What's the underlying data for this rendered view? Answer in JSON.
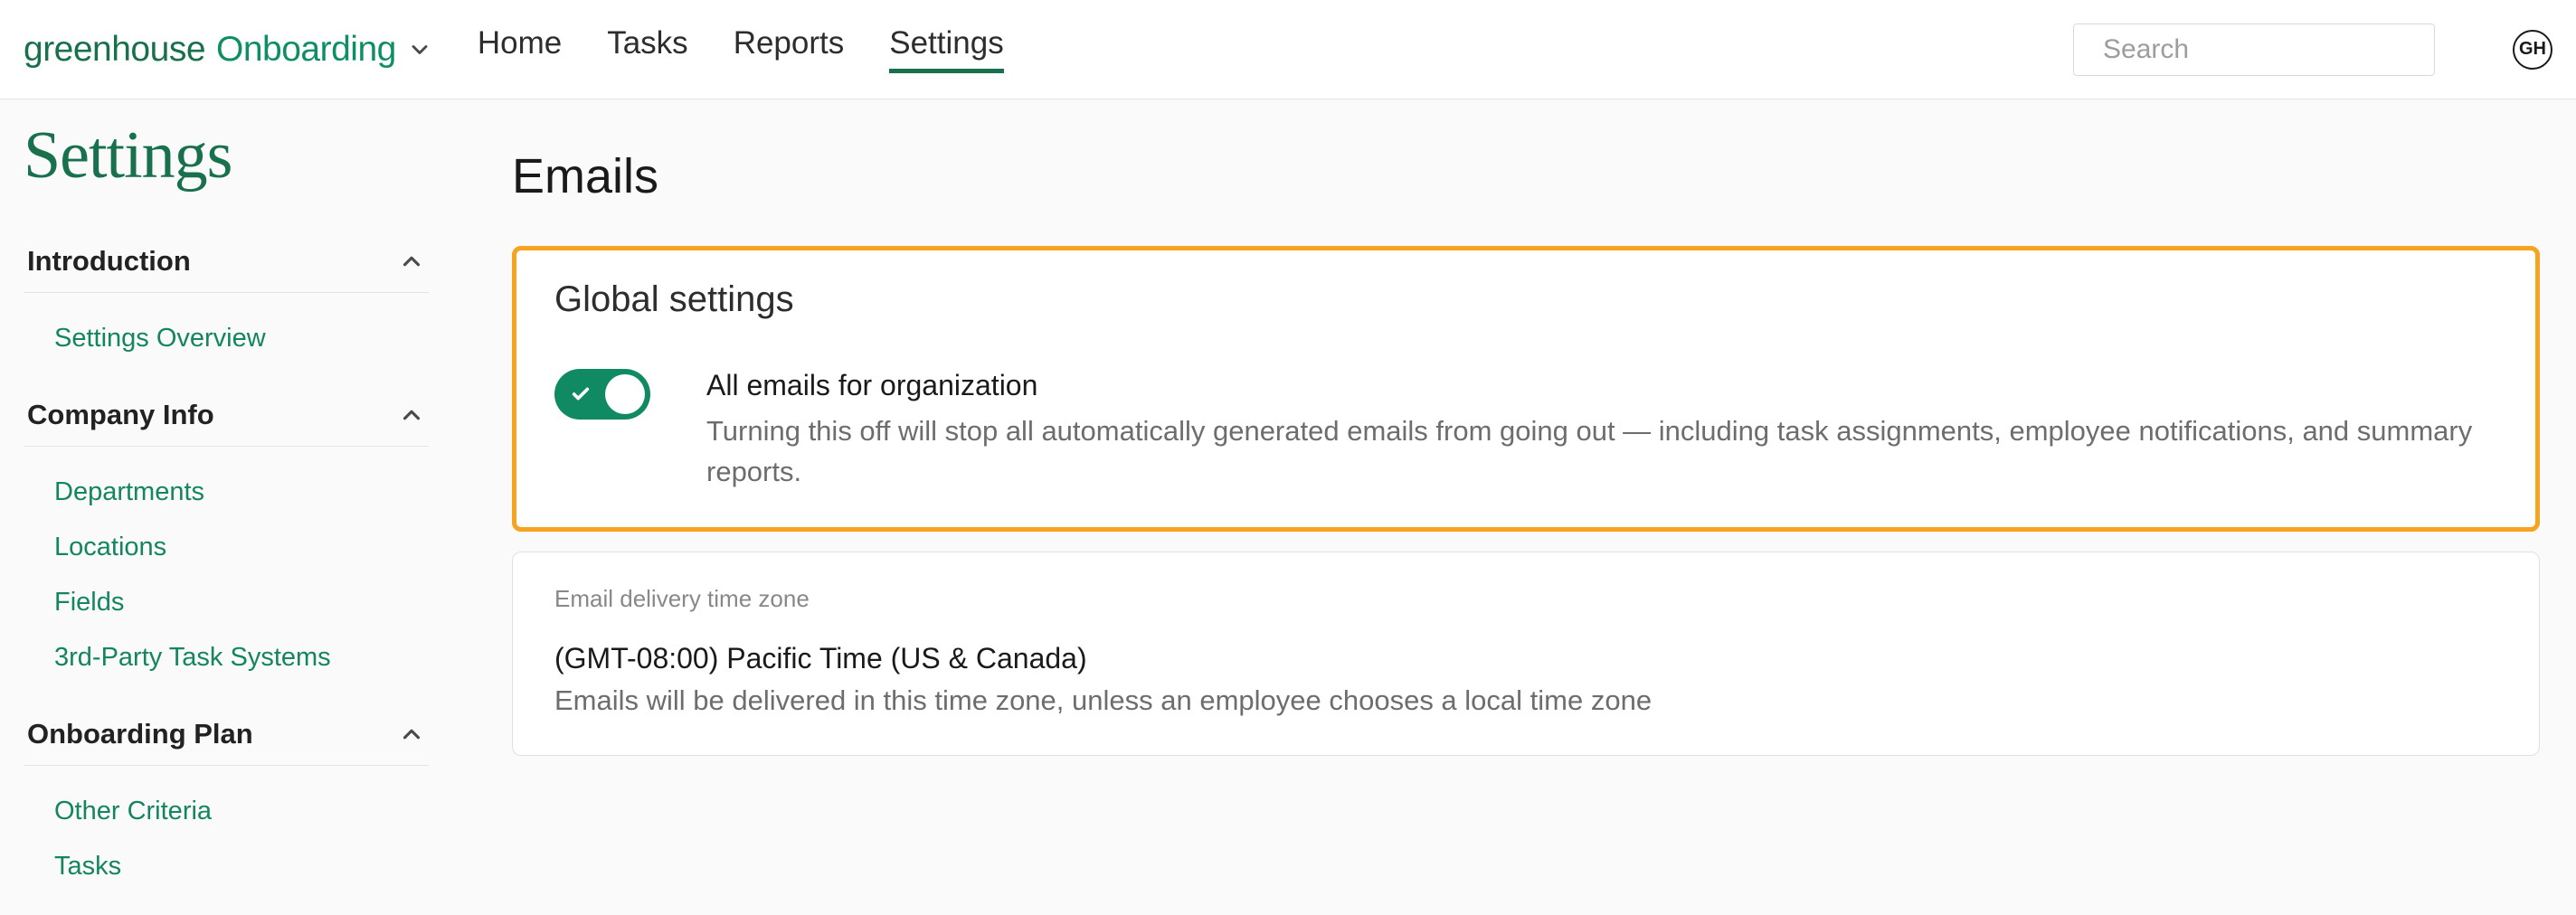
{
  "brand": {
    "word1": "greenhouse",
    "word2": "Onboarding"
  },
  "nav": {
    "home": "Home",
    "tasks": "Tasks",
    "reports": "Reports",
    "settings": "Settings"
  },
  "search": {
    "placeholder": "Search"
  },
  "avatar": {
    "initials": "GH"
  },
  "page_title": "Settings",
  "sidebar": {
    "sections": [
      {
        "title": "Introduction",
        "items": [
          "Settings Overview"
        ]
      },
      {
        "title": "Company Info",
        "items": [
          "Departments",
          "Locations",
          "Fields",
          "3rd-Party Task Systems"
        ]
      },
      {
        "title": "Onboarding Plan",
        "items": [
          "Other Criteria",
          "Tasks"
        ]
      }
    ]
  },
  "main": {
    "heading": "Emails",
    "global": {
      "title": "Global settings",
      "toggle_label": "All emails for organization",
      "toggle_desc": "Turning this off will stop all automatically generated emails from going out — including task assignments, employee notifications, and summary reports."
    },
    "tz": {
      "mini": "Email delivery time zone",
      "value": "(GMT-08:00) Pacific Time (US & Canada)",
      "desc": "Emails will be delivered in this time zone, unless an employee chooses a local time zone"
    }
  }
}
